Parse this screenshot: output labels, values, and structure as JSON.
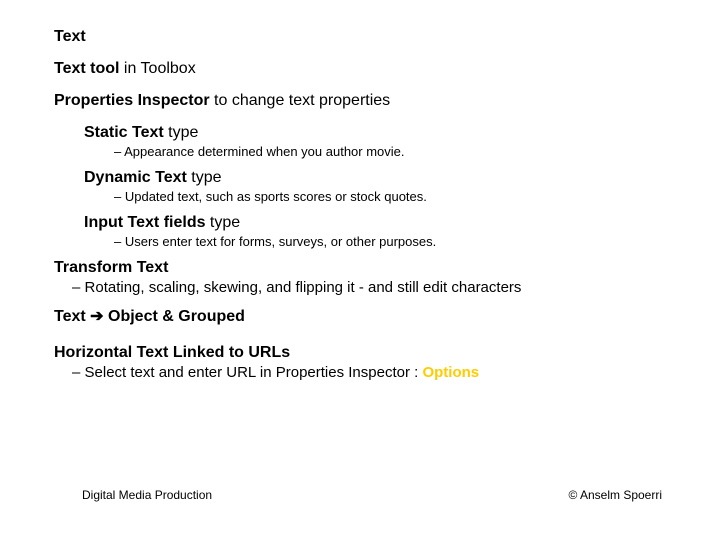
{
  "title": "Text",
  "line_toolbox_bold": "Text tool",
  "line_toolbox_rest": " in Toolbox",
  "line_propinsp_bold": "Properties Inspector",
  "line_propinsp_rest": " to change text properties",
  "static_bold": "Static Text",
  "static_rest": " type",
  "static_bullet": "Appearance determined when you author movie.",
  "dynamic_bold": "Dynamic Text",
  "dynamic_rest": " type",
  "dynamic_bullet": "Updated text, such as sports scores or stock quotes.",
  "input_bold": "Input Text fields",
  "input_rest": " type",
  "input_bullet": "Users enter text for forms, surveys, or other purposes.",
  "transform_heading": "Transform Text",
  "transform_bullet": "Rotating, scaling, skewing, and flipping it - and still edit characters",
  "obj_grouped_pre": "Text ",
  "obj_grouped_arrow": "➔",
  "obj_grouped_post": " Object & Grouped",
  "urls_heading": "Horizontal Text Linked to URLs",
  "urls_bullet_pre": "Select text and enter URL in Properties Inspector : ",
  "urls_bullet_opt": "Options",
  "footer_left": "Digital Media Production",
  "footer_right": "© Anselm Spoerri"
}
